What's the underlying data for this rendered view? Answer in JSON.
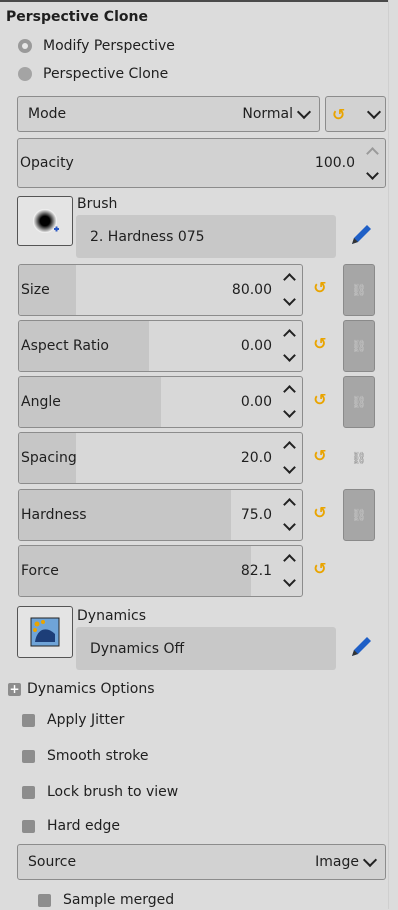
{
  "title": "Perspective Clone",
  "radios": [
    {
      "label": "Modify Perspective",
      "selected": true
    },
    {
      "label": "Perspective Clone",
      "selected": false
    }
  ],
  "mode": {
    "label": "Mode",
    "value": "Normal"
  },
  "opacity": {
    "label": "Opacity",
    "value": "100.0"
  },
  "brush": {
    "header": "Brush",
    "name": "2. Hardness 075"
  },
  "sliders": [
    {
      "label": "Size",
      "value": "80.00",
      "fill_pct": 20,
      "chain": true
    },
    {
      "label": "Aspect Ratio",
      "value": "0.00",
      "fill_pct": 46,
      "chain": true
    },
    {
      "label": "Angle",
      "value": "0.00",
      "fill_pct": 50,
      "chain": true
    },
    {
      "label": "Spacing",
      "value": "20.0",
      "fill_pct": 20,
      "chain": false
    },
    {
      "label": "Hardness",
      "value": "75.0",
      "fill_pct": 75,
      "chain": true
    },
    {
      "label": "Force",
      "value": "82.1",
      "fill_pct": 82,
      "chain": null
    }
  ],
  "dynamics": {
    "header": "Dynamics",
    "name": "Dynamics Off",
    "options_label": "Dynamics Options"
  },
  "checks": [
    {
      "label": "Apply Jitter"
    },
    {
      "label": "Smooth stroke"
    },
    {
      "label": "Lock brush to view"
    },
    {
      "label": "Hard edge"
    }
  ],
  "source": {
    "label": "Source",
    "value": "Image"
  },
  "sample_merged": "Sample merged",
  "icons": {
    "reset": "reset-icon",
    "chain": "chain-link-icon",
    "edit": "pencil-icon",
    "spin_up": "chevron-up-icon",
    "spin_down": "chevron-down-icon"
  },
  "colors": {
    "accent_reset": "#e9a400",
    "pencil": "#1f5fc6"
  }
}
